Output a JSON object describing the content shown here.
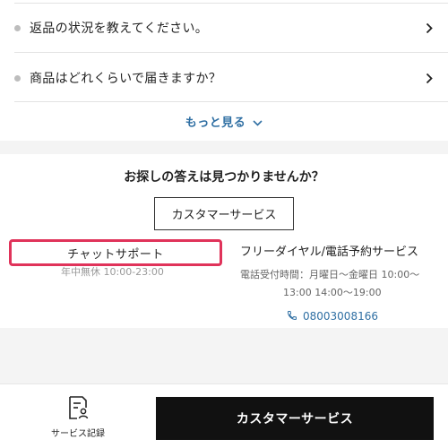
{
  "faq": {
    "items": [
      {
        "question": "返品の状況を教えてください。"
      },
      {
        "question": "商品はどれくらいで届きますか？"
      }
    ],
    "more_label": "もっと見る"
  },
  "support": {
    "title": "お探しの答えは見つかりませんか？",
    "customer_service_label": "カスタマーサービス",
    "chat": {
      "label": "チャットサポート",
      "hours": "年中無休 10:00-23:00"
    },
    "phone": {
      "title": "フリーダイヤル/電話予約サービス",
      "hours_line1": "電話受付時間：月曜日～金曜日 10:00～",
      "hours_line2": "13:00 14:00～19:00",
      "number": "08003008166"
    }
  },
  "bottom_bar": {
    "record_label": "サービス記録",
    "cta_label": "カスタマーサービス"
  },
  "colors": {
    "link_blue": "#2f6fa3",
    "highlight_red": "#e0335a",
    "cta_black": "#111111"
  }
}
